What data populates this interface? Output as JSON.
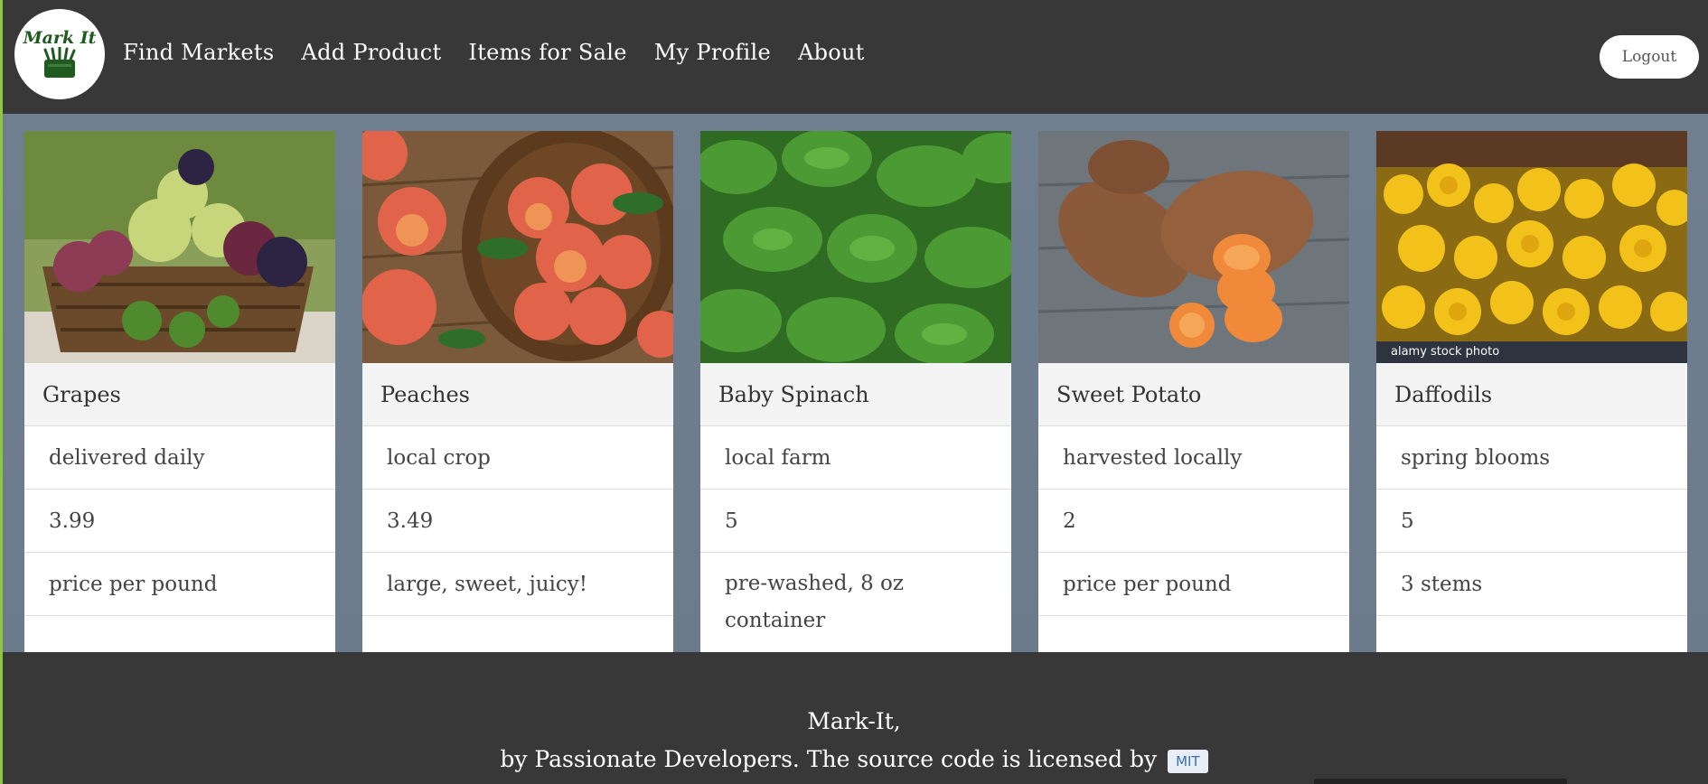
{
  "logo": {
    "text": "Mark It"
  },
  "nav": {
    "links": [
      "Find Markets",
      "Add Product",
      "Items for Sale",
      "My Profile",
      "About"
    ],
    "logout_label": "Logout"
  },
  "products": [
    {
      "title": "Grapes",
      "description": "delivered daily",
      "price": "3.99",
      "unit": "price per pound"
    },
    {
      "title": "Peaches",
      "description": "local crop",
      "price": "3.49",
      "unit": "large, sweet, juicy!"
    },
    {
      "title": "Baby Spinach",
      "description": "local farm",
      "price": "5",
      "unit": "pre-washed, 8 oz container"
    },
    {
      "title": "Sweet Potato",
      "description": "harvested locally",
      "price": "2",
      "unit": "price per pound"
    },
    {
      "title": "Daffodils",
      "description": "spring blooms",
      "price": "5",
      "unit": "3 stems",
      "watermark": "alamy stock photo"
    }
  ],
  "footer": {
    "line1": "Mark-It,",
    "line2": "by Passionate Developers. The source code is licensed by",
    "license": "MIT"
  },
  "colors": {
    "navbar": "#383838",
    "background": "#6b7d8f",
    "accent": "#8dc63f",
    "logo_green": "#1f5a1f"
  }
}
